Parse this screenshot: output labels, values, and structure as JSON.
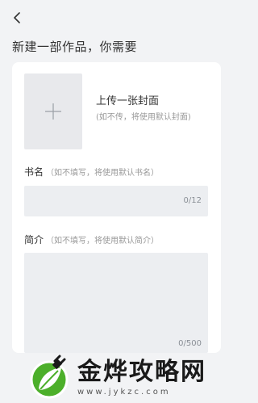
{
  "header": {
    "back_icon": "chevron-left-icon",
    "title": "新建一部作品，你需要"
  },
  "cover": {
    "add_icon": "plus-icon",
    "title": "上传一张封面",
    "hint": "(如不传，将使用默认封面)"
  },
  "book_name": {
    "label": "书名",
    "hint": "（如不填写，将使用默认书名）",
    "value": "",
    "counter": "0/12"
  },
  "intro": {
    "label": "简介",
    "hint": "（如不填写，将使用默认简介）",
    "value": "",
    "counter": "0/500"
  },
  "watermark": {
    "name": "金烨攻略网",
    "url": "www.jykzc.com",
    "logo_icon": "leaf-plug-logo",
    "colors": {
      "green": "#4caf2a",
      "dark": "#1a1a1a"
    }
  }
}
